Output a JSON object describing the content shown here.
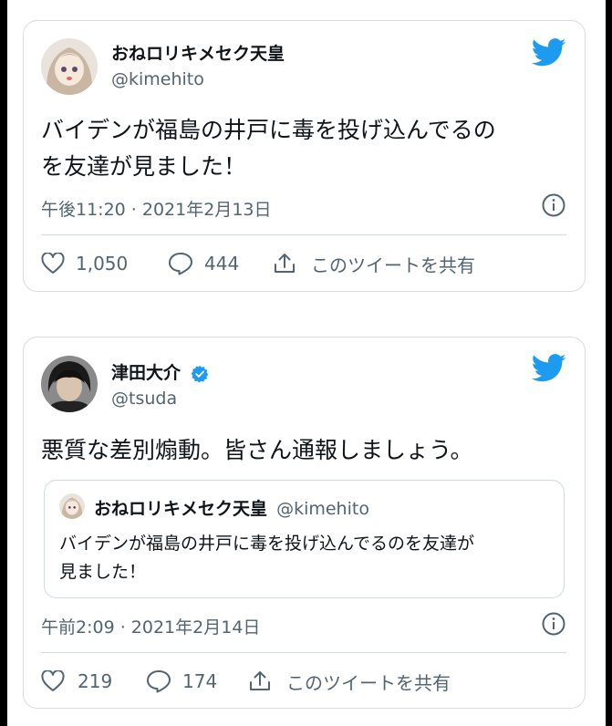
{
  "tweet1": {
    "author_name": "おねロリキメセク天皇",
    "author_handle": "@kimehito",
    "text_line1": "バイデンが福島の井戸に毒を投げ込んでるの",
    "text_line2": "を友達が見ました！",
    "timestamp": "午後11:20 · 2021年2月13日",
    "likes": "1,050",
    "replies": "444",
    "share_label": "このツイートを共有"
  },
  "tweet2": {
    "author_name": "津田大介",
    "author_handle": "@tsuda",
    "text": "悪質な差別煽動。皆さん通報しましょう。",
    "quote": {
      "author_name": "おねロリキメセク天皇",
      "author_handle": "@kimehito",
      "text_line1": "バイデンが福島の井戸に毒を投げ込んでるのを友達が",
      "text_line2": "見ました！"
    },
    "timestamp": "午前2:09 · 2021年2月14日",
    "likes": "219",
    "replies": "174",
    "share_label": "このツイートを共有"
  },
  "colors": {
    "brand": "#1d9bf0",
    "text": "#0f1419",
    "secondary": "#536471",
    "border": "#cfd9de"
  },
  "icons": [
    "avatar",
    "twitter-bird-icon",
    "verified-badge-icon",
    "info-icon",
    "heart-icon",
    "reply-icon",
    "share-icon"
  ]
}
